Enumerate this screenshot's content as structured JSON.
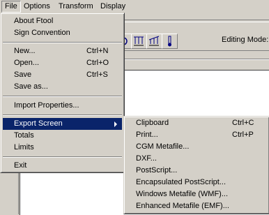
{
  "menubar": {
    "items": [
      "File",
      "Options",
      "Transform",
      "Display"
    ]
  },
  "toolbar": {
    "editing_mode_label": "Editing Mode:"
  },
  "file_menu": {
    "items": [
      {
        "label": "About Ftool",
        "shortcut": ""
      },
      {
        "label": "Sign Convention",
        "shortcut": ""
      },
      {
        "label": "New...",
        "shortcut": "Ctrl+N"
      },
      {
        "label": "Open...",
        "shortcut": "Ctrl+O"
      },
      {
        "label": "Save",
        "shortcut": "Ctrl+S"
      },
      {
        "label": "Save as...",
        "shortcut": ""
      },
      {
        "label": "Import Properties...",
        "shortcut": ""
      },
      {
        "label": "Export Screen",
        "shortcut": ""
      },
      {
        "label": "Totals",
        "shortcut": ""
      },
      {
        "label": "Limits",
        "shortcut": ""
      },
      {
        "label": "Exit",
        "shortcut": ""
      }
    ]
  },
  "export_menu": {
    "items": [
      {
        "label": "Clipboard",
        "shortcut": "Ctrl+C"
      },
      {
        "label": "Print...",
        "shortcut": "Ctrl+P"
      },
      {
        "label": "CGM Metafile...",
        "shortcut": ""
      },
      {
        "label": "DXF...",
        "shortcut": ""
      },
      {
        "label": "PostScript...",
        "shortcut": ""
      },
      {
        "label": "Encapsulated PostScript...",
        "shortcut": ""
      },
      {
        "label": "Windows Metafile (WMF)...",
        "shortcut": ""
      },
      {
        "label": "Enhanced Metafile (EMF)...",
        "shortcut": ""
      }
    ]
  },
  "colors": {
    "menu_highlight": "#0a246a",
    "face": "#d4d0c8"
  }
}
